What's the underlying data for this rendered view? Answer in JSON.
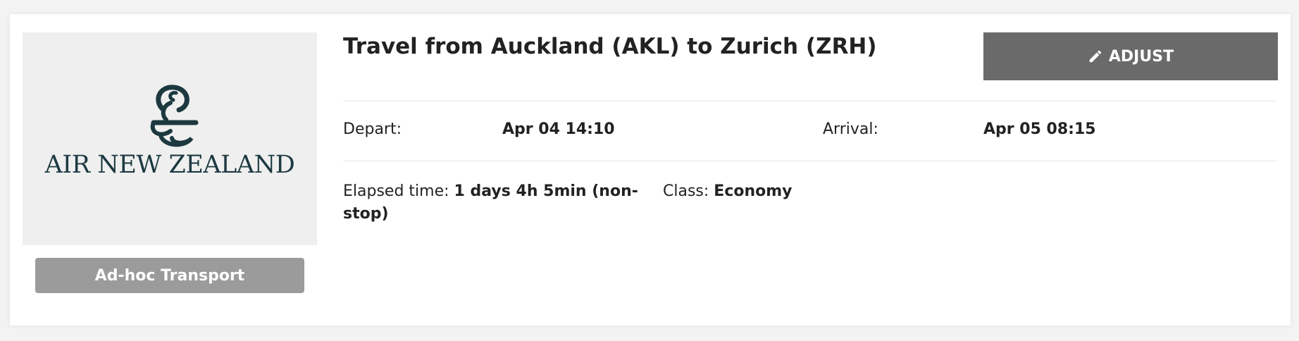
{
  "airline": {
    "logo_text": "AIR NEW ZEALAND",
    "logo_icon": "koru-icon",
    "brand_color": "#1c3940"
  },
  "transport_button": {
    "label": "Ad-hoc Transport"
  },
  "trip": {
    "title": "Travel from Auckland (AKL) to Zurich (ZRH)"
  },
  "adjust_button": {
    "label": "ADJUST",
    "icon": "pencil-icon"
  },
  "times": {
    "depart_label": "Depart:",
    "depart_value": "Apr 04 14:10",
    "arrival_label": "Arrival:",
    "arrival_value": "Apr 05 08:15"
  },
  "details": {
    "elapsed_label": "Elapsed time:",
    "elapsed_value": "1 days 4h 5min (non-stop)",
    "class_label": "Class:",
    "class_value": "Economy"
  },
  "colors": {
    "button_gray": "#9b9b9b",
    "adjust_gray": "#6a6a6a",
    "logo_background": "#efefef"
  }
}
